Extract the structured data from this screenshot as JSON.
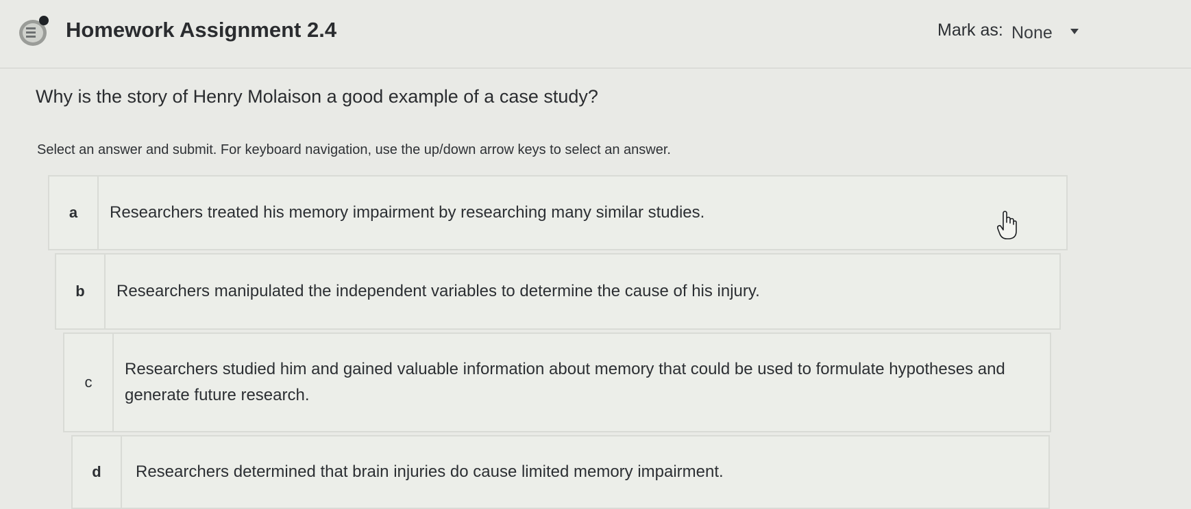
{
  "header": {
    "title": "Homework Assignment 2.4",
    "mark_label": "Mark as:",
    "mark_value": "None",
    "icon": "assignment-icon"
  },
  "question": {
    "prompt": "Why is the story of Henry Molaison a good example of a case study?",
    "instructions": "Select an answer and submit. For keyboard navigation, use the up/down arrow keys to select an answer."
  },
  "answers": [
    {
      "letter": "a",
      "text": "Researchers treated his memory impairment by researching many similar studies."
    },
    {
      "letter": "b",
      "text": "Researchers manipulated the independent variables to determine the cause of his injury."
    },
    {
      "letter": "c",
      "text": "Researchers studied him and gained valuable information about memory that could be used to formulate hypotheses and generate future research."
    },
    {
      "letter": "d",
      "text": "Researchers determined that brain injuries do cause limited memory impairment."
    }
  ],
  "cursor": {
    "icon": "hand-pointer-icon"
  },
  "colors": {
    "background": "#e9eae6",
    "border": "#d9dbd6",
    "text": "#2c2f33"
  }
}
